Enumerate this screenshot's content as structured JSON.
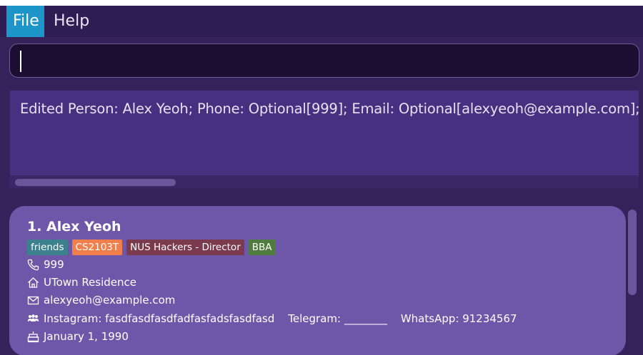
{
  "menu": {
    "file": "File",
    "help": "Help"
  },
  "command": {
    "value": ""
  },
  "result": {
    "text": "Edited Person: Alex Yeoh; Phone: Optional[999]; Email: Optional[alexyeoh@example.com]; Birthday"
  },
  "persons": [
    {
      "index_name": "1.  Alex Yeoh",
      "tags": [
        {
          "label": "friends",
          "color": "#3c7f8d"
        },
        {
          "label": "CS2103T",
          "color": "#f07f4c"
        },
        {
          "label": "NUS Hackers - Director",
          "color": "#7c3a4e"
        },
        {
          "label": "BBA",
          "color": "#4d7c3e"
        }
      ],
      "phone": "999",
      "address": "UTown Residence",
      "email": "alexyeoh@example.com",
      "instagram": "Instagram: fasdfasdfasdfadfasfadsfasdfasd",
      "telegram": "Telegram: ________",
      "whatsapp": "WhatsApp: 91234567",
      "birthday": "January 1, 1990"
    }
  ],
  "colors": {
    "background": "#35225a",
    "menu_active": "#1e95c9",
    "card": "#6e56a8"
  },
  "icons": {
    "phone": "phone-icon",
    "address": "home-icon",
    "email": "envelope-icon",
    "socials": "people-icon",
    "birthday": "cake-icon"
  }
}
